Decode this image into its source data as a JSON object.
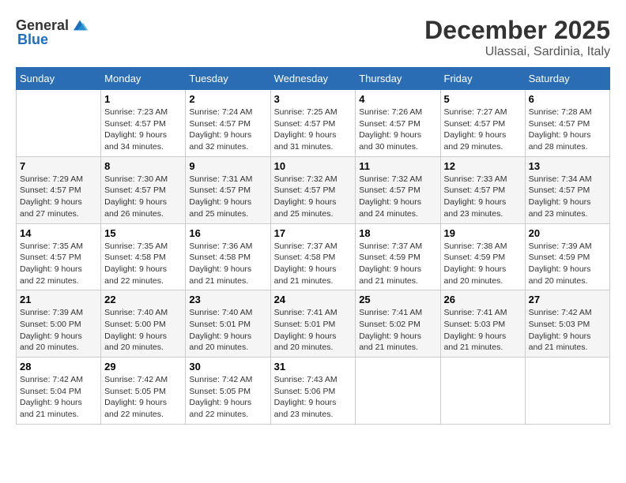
{
  "logo": {
    "general": "General",
    "blue": "Blue"
  },
  "title": "December 2025",
  "location": "Ulassai, Sardinia, Italy",
  "weekdays": [
    "Sunday",
    "Monday",
    "Tuesday",
    "Wednesday",
    "Thursday",
    "Friday",
    "Saturday"
  ],
  "weeks": [
    [
      {
        "day": "",
        "info": ""
      },
      {
        "day": "1",
        "info": "Sunrise: 7:23 AM\nSunset: 4:57 PM\nDaylight: 9 hours\nand 34 minutes."
      },
      {
        "day": "2",
        "info": "Sunrise: 7:24 AM\nSunset: 4:57 PM\nDaylight: 9 hours\nand 32 minutes."
      },
      {
        "day": "3",
        "info": "Sunrise: 7:25 AM\nSunset: 4:57 PM\nDaylight: 9 hours\nand 31 minutes."
      },
      {
        "day": "4",
        "info": "Sunrise: 7:26 AM\nSunset: 4:57 PM\nDaylight: 9 hours\nand 30 minutes."
      },
      {
        "day": "5",
        "info": "Sunrise: 7:27 AM\nSunset: 4:57 PM\nDaylight: 9 hours\nand 29 minutes."
      },
      {
        "day": "6",
        "info": "Sunrise: 7:28 AM\nSunset: 4:57 PM\nDaylight: 9 hours\nand 28 minutes."
      }
    ],
    [
      {
        "day": "7",
        "info": "Sunrise: 7:29 AM\nSunset: 4:57 PM\nDaylight: 9 hours\nand 27 minutes."
      },
      {
        "day": "8",
        "info": "Sunrise: 7:30 AM\nSunset: 4:57 PM\nDaylight: 9 hours\nand 26 minutes."
      },
      {
        "day": "9",
        "info": "Sunrise: 7:31 AM\nSunset: 4:57 PM\nDaylight: 9 hours\nand 25 minutes."
      },
      {
        "day": "10",
        "info": "Sunrise: 7:32 AM\nSunset: 4:57 PM\nDaylight: 9 hours\nand 25 minutes."
      },
      {
        "day": "11",
        "info": "Sunrise: 7:32 AM\nSunset: 4:57 PM\nDaylight: 9 hours\nand 24 minutes."
      },
      {
        "day": "12",
        "info": "Sunrise: 7:33 AM\nSunset: 4:57 PM\nDaylight: 9 hours\nand 23 minutes."
      },
      {
        "day": "13",
        "info": "Sunrise: 7:34 AM\nSunset: 4:57 PM\nDaylight: 9 hours\nand 23 minutes."
      }
    ],
    [
      {
        "day": "14",
        "info": "Sunrise: 7:35 AM\nSunset: 4:57 PM\nDaylight: 9 hours\nand 22 minutes."
      },
      {
        "day": "15",
        "info": "Sunrise: 7:35 AM\nSunset: 4:58 PM\nDaylight: 9 hours\nand 22 minutes."
      },
      {
        "day": "16",
        "info": "Sunrise: 7:36 AM\nSunset: 4:58 PM\nDaylight: 9 hours\nand 21 minutes."
      },
      {
        "day": "17",
        "info": "Sunrise: 7:37 AM\nSunset: 4:58 PM\nDaylight: 9 hours\nand 21 minutes."
      },
      {
        "day": "18",
        "info": "Sunrise: 7:37 AM\nSunset: 4:59 PM\nDaylight: 9 hours\nand 21 minutes."
      },
      {
        "day": "19",
        "info": "Sunrise: 7:38 AM\nSunset: 4:59 PM\nDaylight: 9 hours\nand 20 minutes."
      },
      {
        "day": "20",
        "info": "Sunrise: 7:39 AM\nSunset: 4:59 PM\nDaylight: 9 hours\nand 20 minutes."
      }
    ],
    [
      {
        "day": "21",
        "info": "Sunrise: 7:39 AM\nSunset: 5:00 PM\nDaylight: 9 hours\nand 20 minutes."
      },
      {
        "day": "22",
        "info": "Sunrise: 7:40 AM\nSunset: 5:00 PM\nDaylight: 9 hours\nand 20 minutes."
      },
      {
        "day": "23",
        "info": "Sunrise: 7:40 AM\nSunset: 5:01 PM\nDaylight: 9 hours\nand 20 minutes."
      },
      {
        "day": "24",
        "info": "Sunrise: 7:41 AM\nSunset: 5:01 PM\nDaylight: 9 hours\nand 20 minutes."
      },
      {
        "day": "25",
        "info": "Sunrise: 7:41 AM\nSunset: 5:02 PM\nDaylight: 9 hours\nand 21 minutes."
      },
      {
        "day": "26",
        "info": "Sunrise: 7:41 AM\nSunset: 5:03 PM\nDaylight: 9 hours\nand 21 minutes."
      },
      {
        "day": "27",
        "info": "Sunrise: 7:42 AM\nSunset: 5:03 PM\nDaylight: 9 hours\nand 21 minutes."
      }
    ],
    [
      {
        "day": "28",
        "info": "Sunrise: 7:42 AM\nSunset: 5:04 PM\nDaylight: 9 hours\nand 21 minutes."
      },
      {
        "day": "29",
        "info": "Sunrise: 7:42 AM\nSunset: 5:05 PM\nDaylight: 9 hours\nand 22 minutes."
      },
      {
        "day": "30",
        "info": "Sunrise: 7:42 AM\nSunset: 5:05 PM\nDaylight: 9 hours\nand 22 minutes."
      },
      {
        "day": "31",
        "info": "Sunrise: 7:43 AM\nSunset: 5:06 PM\nDaylight: 9 hours\nand 23 minutes."
      },
      {
        "day": "",
        "info": ""
      },
      {
        "day": "",
        "info": ""
      },
      {
        "day": "",
        "info": ""
      }
    ]
  ]
}
